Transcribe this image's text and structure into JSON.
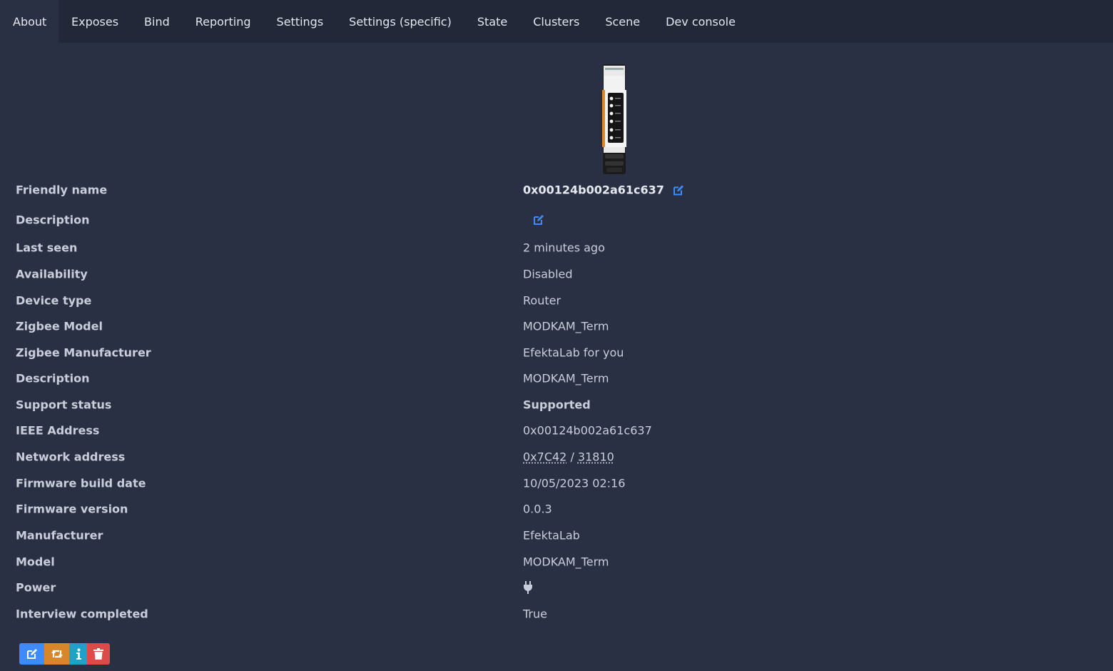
{
  "tabs": [
    {
      "label": "About",
      "active": true
    },
    {
      "label": "Exposes"
    },
    {
      "label": "Bind"
    },
    {
      "label": "Reporting"
    },
    {
      "label": "Settings"
    },
    {
      "label": "Settings (specific)"
    },
    {
      "label": "State"
    },
    {
      "label": "Clusters"
    },
    {
      "label": "Scene"
    },
    {
      "label": "Dev console"
    }
  ],
  "device": {
    "image_icon": "din-rail-device-image",
    "friendly_name": {
      "label": "Friendly name",
      "value": "0x00124b002a61c637"
    },
    "description": {
      "label": "Description",
      "value": ""
    },
    "last_seen": {
      "label": "Last seen",
      "value": "2 minutes ago"
    },
    "availability": {
      "label": "Availability",
      "value": "Disabled"
    },
    "device_type": {
      "label": "Device type",
      "value": "Router"
    },
    "zigbee_model": {
      "label": "Zigbee Model",
      "value": "MODKAM_Term"
    },
    "zigbee_manufacturer": {
      "label": "Zigbee Manufacturer",
      "value": "EfektaLab for you"
    },
    "description2": {
      "label": "Description",
      "value": "MODKAM_Term"
    },
    "support_status": {
      "label": "Support status",
      "value": "Supported"
    },
    "ieee_address": {
      "label": "IEEE Address",
      "value": "0x00124b002a61c637"
    },
    "network_address": {
      "label": "Network address",
      "hex": "0x7C42",
      "separator": " / ",
      "dec": "31810"
    },
    "firmware_build_date": {
      "label": "Firmware build date",
      "value": "10/05/2023 02:16"
    },
    "firmware_version": {
      "label": "Firmware version",
      "value": "0.0.3"
    },
    "manufacturer": {
      "label": "Manufacturer",
      "value": "EfektaLab"
    },
    "model": {
      "label": "Model",
      "value": "MODKAM_Term"
    },
    "power": {
      "label": "Power",
      "icon": "plug-icon"
    },
    "interview_completed": {
      "label": "Interview completed",
      "value": "True"
    }
  },
  "actions": [
    {
      "name": "rename",
      "icon": "edit-icon",
      "color": "#3d8bfd"
    },
    {
      "name": "reconfigure",
      "icon": "retweet-icon",
      "color": "#d9862a"
    },
    {
      "name": "interview",
      "icon": "info-icon",
      "color": "#1fa1c9"
    },
    {
      "name": "remove",
      "icon": "trash-icon",
      "color": "#dc4a4a"
    }
  ],
  "colors": {
    "background": "#2a3043",
    "tabbar": "#222838",
    "link": "#3d8bfd",
    "supported": "#3fbf6a"
  }
}
